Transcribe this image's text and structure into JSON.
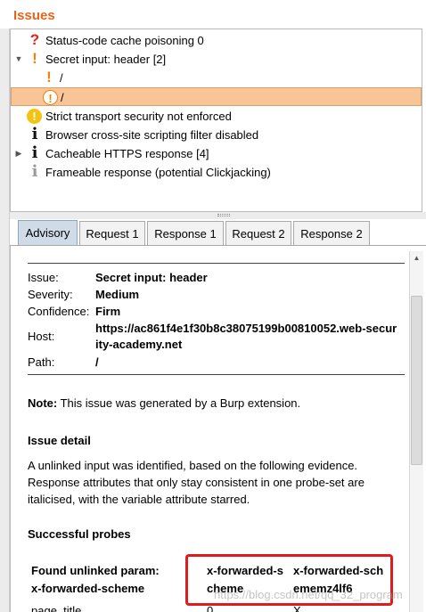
{
  "issues_panel": {
    "title": "Issues",
    "items": [
      {
        "icon": "question-icon",
        "label": "Status-code cache poisoning 0",
        "expander": ""
      },
      {
        "icon": "exclamation-icon",
        "label": "Secret input: header [2]",
        "expander": "▼"
      },
      {
        "icon": "exclamation-icon",
        "label": "/",
        "expander": ""
      },
      {
        "icon": "exclamation-circle-icon",
        "label": "/",
        "expander": "",
        "selected": true
      },
      {
        "icon": "warning-circle-icon",
        "label": "Strict transport security not enforced",
        "expander": ""
      },
      {
        "icon": "info-icon",
        "label": "Browser cross-site scripting filter disabled",
        "expander": ""
      },
      {
        "icon": "info-icon",
        "label": "Cacheable HTTPS response [4]",
        "expander": "▶"
      },
      {
        "icon": "info-grey-icon",
        "label": "Frameable response (potential Clickjacking)",
        "expander": ""
      }
    ]
  },
  "tabs": [
    "Advisory",
    "Request 1",
    "Response 1",
    "Request 2",
    "Response 2"
  ],
  "advisory": {
    "issue_label": "Issue:",
    "issue_value": "Secret input: header",
    "severity_label": "Severity:",
    "severity_value": "Medium",
    "confidence_label": "Confidence:",
    "confidence_value": "Firm",
    "host_label": "Host:",
    "host_value_line1": "https://ac861f4e1f30b8c38075199b00810052.web-secur",
    "host_value_line2": "ity-academy.net",
    "path_label": "Path:",
    "path_value": "/",
    "note_label": "Note:",
    "note_text": " This issue was generated by a Burp extension.",
    "issue_detail_heading": "Issue detail",
    "issue_detail_line1": "A unlinked input was identified, based on the following evidence.",
    "issue_detail_line2": "Response attributes that only stay consistent in one probe-set are",
    "issue_detail_line3": "italicised, with the variable attribute starred.",
    "probes_heading": "Successful probes",
    "probe_key_line1": "Found unlinked param:",
    "probe_key_line2": "x-forwarded-scheme",
    "probe_col1_line1": "x-forwarded-s",
    "probe_col1_line2": "cheme",
    "probe_col2_line1": "x-forwarded-sch",
    "probe_col2_line2": "ememz4lf6",
    "next_row_key": "page_title",
    "next_row_col1": "0",
    "next_row_col2": "X"
  },
  "watermark": "https://blog.csdn.net/qq_32_program"
}
